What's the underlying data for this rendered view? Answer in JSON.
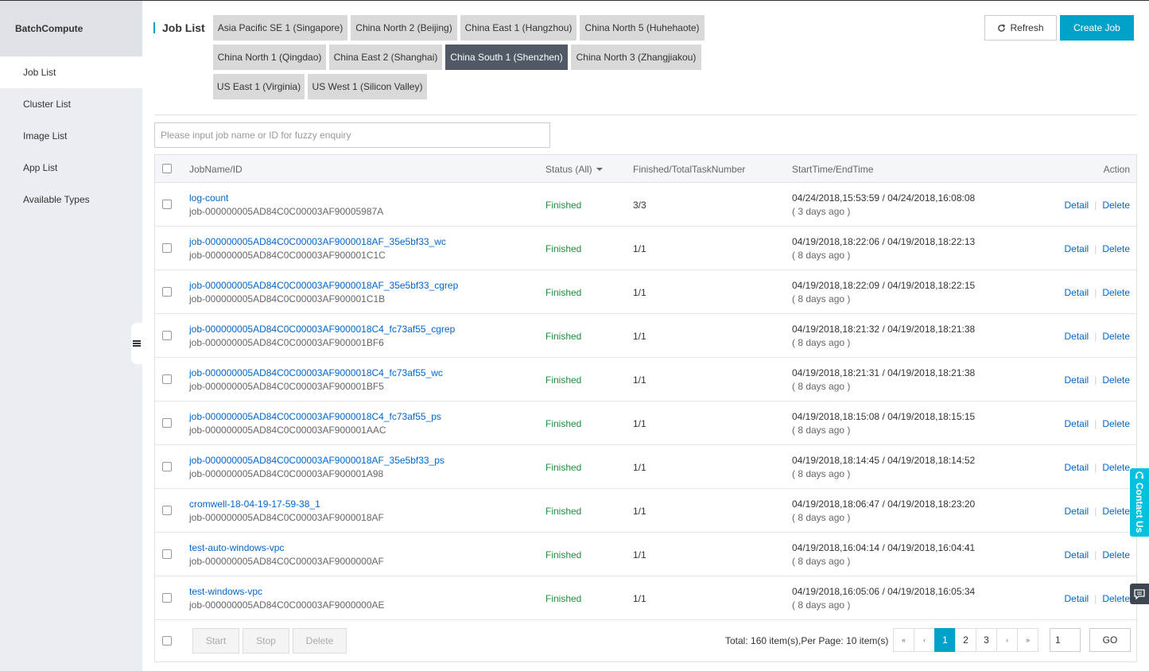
{
  "sidebar": {
    "title": "BatchCompute",
    "items": [
      {
        "label": "Job List",
        "active": true
      },
      {
        "label": "Cluster List"
      },
      {
        "label": "Image List"
      },
      {
        "label": "App List"
      },
      {
        "label": "Available Types"
      }
    ]
  },
  "header": {
    "title": "Job List",
    "refresh_label": "Refresh",
    "create_label": "Create Job"
  },
  "regions": [
    {
      "label": "Asia Pacific SE 1 (Singapore)"
    },
    {
      "label": "China North 2 (Beijing)"
    },
    {
      "label": "China East 1 (Hangzhou)"
    },
    {
      "label": "China North 5 (Huhehaote)"
    },
    {
      "label": "China North 1 (Qingdao)"
    },
    {
      "label": "China East 2 (Shanghai)"
    },
    {
      "label": "China South 1 (Shenzhen)",
      "active": true
    },
    {
      "label": "China North 3 (Zhangjiakou)"
    },
    {
      "label": "US East 1 (Virginia)"
    },
    {
      "label": "US West 1 (Silicon Valley)"
    }
  ],
  "search": {
    "placeholder": "Please input job name or ID for fuzzy enquiry",
    "value": ""
  },
  "table": {
    "columns": {
      "name": "JobName/ID",
      "status": "Status (All)",
      "tasks": "Finished/TotalTaskNumber",
      "time": "StartTime/EndTime",
      "action": "Action"
    },
    "detail_label": "Detail",
    "delete_label": "Delete",
    "rows": [
      {
        "name": "log-count",
        "id": "job-000000005AD84C0C00003AF90005987A",
        "status": "Finished",
        "tasks": "3/3",
        "time": "04/24/2018,15:53:59 / 04/24/2018,16:08:08",
        "ago": "( 3 days ago )"
      },
      {
        "name": "job-000000005AD84C0C00003AF9000018AF_35e5bf33_wc",
        "id": "job-000000005AD84C0C00003AF900001C1C",
        "status": "Finished",
        "tasks": "1/1",
        "time": "04/19/2018,18:22:06 / 04/19/2018,18:22:13",
        "ago": "( 8 days ago )"
      },
      {
        "name": "job-000000005AD84C0C00003AF9000018AF_35e5bf33_cgrep",
        "id": "job-000000005AD84C0C00003AF900001C1B",
        "status": "Finished",
        "tasks": "1/1",
        "time": "04/19/2018,18:22:09 / 04/19/2018,18:22:15",
        "ago": "( 8 days ago )"
      },
      {
        "name": "job-000000005AD84C0C00003AF9000018C4_fc73af55_cgrep",
        "id": "job-000000005AD84C0C00003AF900001BF6",
        "status": "Finished",
        "tasks": "1/1",
        "time": "04/19/2018,18:21:32 / 04/19/2018,18:21:38",
        "ago": "( 8 days ago )"
      },
      {
        "name": "job-000000005AD84C0C00003AF9000018C4_fc73af55_wc",
        "id": "job-000000005AD84C0C00003AF900001BF5",
        "status": "Finished",
        "tasks": "1/1",
        "time": "04/19/2018,18:21:31 / 04/19/2018,18:21:38",
        "ago": "( 8 days ago )"
      },
      {
        "name": "job-000000005AD84C0C00003AF9000018C4_fc73af55_ps",
        "id": "job-000000005AD84C0C00003AF900001AAC",
        "status": "Finished",
        "tasks": "1/1",
        "time": "04/19/2018,18:15:08 / 04/19/2018,18:15:15",
        "ago": "( 8 days ago )"
      },
      {
        "name": "job-000000005AD84C0C00003AF9000018AF_35e5bf33_ps",
        "id": "job-000000005AD84C0C00003AF900001A98",
        "status": "Finished",
        "tasks": "1/1",
        "time": "04/19/2018,18:14:45 / 04/19/2018,18:14:52",
        "ago": "( 8 days ago )"
      },
      {
        "name": "cromwell-18-04-19-17-59-38_1",
        "id": "job-000000005AD84C0C00003AF9000018AF",
        "status": "Finished",
        "tasks": "1/1",
        "time": "04/19/2018,18:06:47 / 04/19/2018,18:23:20",
        "ago": "( 8 days ago )"
      },
      {
        "name": "test-auto-windows-vpc",
        "id": "job-000000005AD84C0C00003AF9000000AF",
        "status": "Finished",
        "tasks": "1/1",
        "time": "04/19/2018,16:04:14 / 04/19/2018,16:04:41",
        "ago": "( 8 days ago )"
      },
      {
        "name": "test-windows-vpc",
        "id": "job-000000005AD84C0C00003AF9000000AE",
        "status": "Finished",
        "tasks": "1/1",
        "time": "04/19/2018,16:05:06 / 04/19/2018,16:05:34",
        "ago": "( 8 days ago )"
      }
    ]
  },
  "footer": {
    "start_label": "Start",
    "stop_label": "Stop",
    "delete_label": "Delete",
    "total_text": "Total: 160 item(s),Per Page: 10 item(s)",
    "pager": {
      "first": "«",
      "prev": "‹",
      "pages": [
        "1",
        "2",
        "3"
      ],
      "current": "1",
      "next": "›",
      "last": "»"
    },
    "goto_value": "1",
    "go_label": "GO"
  },
  "widgets": {
    "contact_label": "Contact Us"
  },
  "colors": {
    "accent": "#00a2ca",
    "active_tab": "#505a66",
    "link": "#0066cc",
    "status_finished": "#1e8e3e",
    "contact": "#00c1de"
  }
}
